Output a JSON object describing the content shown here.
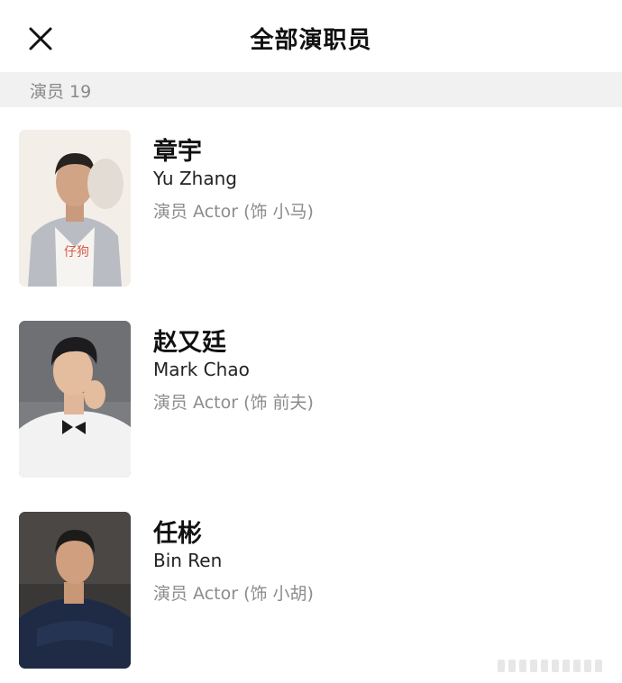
{
  "header": {
    "title": "全部演职员",
    "close_icon": "close-icon"
  },
  "section": {
    "label": "演员 19"
  },
  "cast": [
    {
      "name_cn": "章宇",
      "name_en": "Yu Zhang",
      "role": "演员 Actor (饰 小马)",
      "photo_icon": "portrait-photo"
    },
    {
      "name_cn": "赵又廷",
      "name_en": "Mark Chao",
      "role": "演员 Actor (饰 前夫)",
      "photo_icon": "portrait-photo"
    },
    {
      "name_cn": "任彬",
      "name_en": "Bin Ren",
      "role": "演员 Actor (饰 小胡)",
      "photo_icon": "portrait-photo"
    }
  ]
}
